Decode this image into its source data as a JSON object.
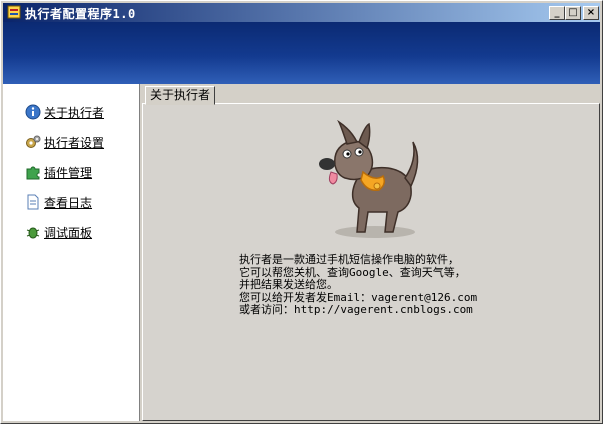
{
  "window": {
    "title": "执行者配置程序1.0",
    "controls": {
      "minimize": "_",
      "maximize": "□",
      "close": "×"
    }
  },
  "sidebar": {
    "items": [
      {
        "label": "关于执行者",
        "icon": "info-icon"
      },
      {
        "label": "执行者设置",
        "icon": "gears-icon"
      },
      {
        "label": "插件管理",
        "icon": "puzzle-icon"
      },
      {
        "label": "查看日志",
        "icon": "document-icon"
      },
      {
        "label": "调试面板",
        "icon": "bug-icon"
      }
    ]
  },
  "main": {
    "tab_label": "关于执行者",
    "about_lines": [
      "执行者是一款通过手机短信操作电脑的软件，",
      "它可以帮您关机、查询Google、查询天气等，",
      "并把结果发送给您。",
      "您可以给开发者发Email：vagerent@126.com",
      "或者访问：http://vagerent.cnblogs.com"
    ]
  },
  "colors": {
    "titlebar": "#0a246a",
    "banner": "#133a8f",
    "dog_collar": "#f5a623"
  }
}
